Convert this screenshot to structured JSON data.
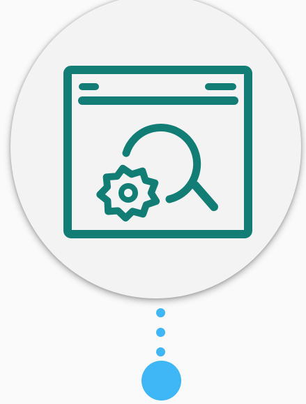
{
  "colors": {
    "background": "#fafafa",
    "card": "#f3f3f3",
    "icon": "#117d74",
    "accent": "#3fb6f6"
  },
  "illustration": {
    "icon_name": "browser-window-search-settings-icon",
    "parts": [
      "window-frame-icon",
      "magnifier-icon",
      "gear-icon"
    ]
  },
  "connector": {
    "dot_count": 3,
    "endpoint": "circle"
  }
}
